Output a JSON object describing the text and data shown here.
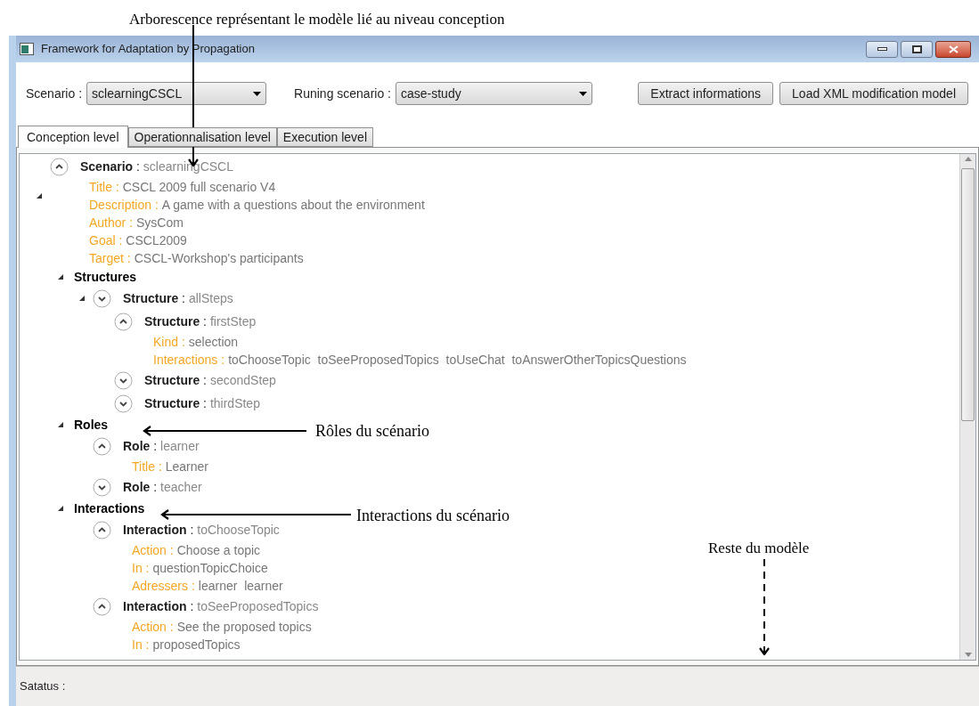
{
  "annotations": [
    {
      "text": "Arborescence représentant le modèle lié au niveau conception",
      "kind": "solid"
    },
    {
      "text": "Rôles du scénario",
      "kind": "solid"
    },
    {
      "text": "Interactions du scénario",
      "kind": "solid"
    },
    {
      "text": "Reste du modèle",
      "kind": "dashed"
    }
  ],
  "window": {
    "title": "Framework for Adaptation by Propagation"
  },
  "toolbar": {
    "scenario_label": "Scenario :",
    "scenario_value": "sclearningCSCL",
    "running_label": "Runing scenario :",
    "running_value": "case-study",
    "buttons": [
      "Extract informations",
      "Load XML modification model"
    ]
  },
  "tabs": [
    {
      "label": "Conception level",
      "selected": true
    },
    {
      "label": "Operationnalisation level",
      "selected": false
    },
    {
      "label": "Execution level",
      "selected": false
    }
  ],
  "tree": [
    {
      "kind": "element",
      "label": "**Scenario** :",
      "value": "sclearningCSCL",
      "expanded": true,
      "expander": true,
      "children": [
        {
          "kind": "property",
          "key": "Title :",
          "value": "CSCL 2009 full scenario V4"
        },
        {
          "kind": "property",
          "key": "Description :",
          "value": "A game with a questions about the environment"
        },
        {
          "kind": "property",
          "key": "Author :",
          "value": "SysCom"
        },
        {
          "kind": "property",
          "key": "Goal :",
          "value": "CSCL2009"
        },
        {
          "kind": "property",
          "key": "Target :",
          "value": "CSCL-Workshop's participants"
        },
        {
          "kind": "section",
          "label": "Structures",
          "expanded": true,
          "children": [
            {
              "kind": "element",
              "label": "**Structure** :",
              "value": "allSteps",
              "expanded": false,
              "expander": true,
              "children": [
                {
                  "kind": "element",
                  "label": "**Structure** :",
                  "value": "firstStep",
                  "expanded": true,
                  "children": [
                    {
                      "kind": "property",
                      "key": "Kind :",
                      "value": "selection"
                    },
                    {
                      "kind": "property",
                      "key": "Interactions :",
                      "value": "toChooseTopic  toSeeProposedTopics  toUseChat  toAnswerOtherTopicsQuestions"
                    }
                  ]
                },
                {
                  "kind": "element",
                  "label": "**Structure** :",
                  "value": "secondStep",
                  "expanded": false
                },
                {
                  "kind": "element",
                  "label": "**Structure** :",
                  "value": "thirdStep",
                  "expanded": false
                }
              ]
            }
          ]
        },
        {
          "kind": "section",
          "label": "Roles",
          "expanded": true,
          "children": [
            {
              "kind": "element",
              "label": "**Role** :",
              "value": "learner",
              "expanded": true,
              "children": [
                {
                  "kind": "property",
                  "key": "Title :",
                  "value": "Learner"
                }
              ]
            },
            {
              "kind": "element",
              "label": "**Role** :",
              "value": "teacher",
              "expanded": false
            }
          ]
        },
        {
          "kind": "section",
          "label": "Interactions",
          "expanded": true,
          "children": [
            {
              "kind": "element",
              "label": "**Interaction** :",
              "value": "toChooseTopic",
              "expanded": true,
              "children": [
                {
                  "kind": "property",
                  "key": "Action :",
                  "value": "Choose a topic"
                },
                {
                  "kind": "property",
                  "key": "In :",
                  "value": "questionTopicChoice"
                },
                {
                  "kind": "property",
                  "key": "Adressers :",
                  "value": "learner  learner"
                }
              ]
            },
            {
              "kind": "element",
              "label": "**Interaction** :",
              "value": "toSeeProposedTopics",
              "expanded": true,
              "children": [
                {
                  "kind": "property",
                  "key": "Action :",
                  "value": "See the proposed topics"
                },
                {
                  "kind": "property",
                  "key": "In :",
                  "value": "proposedTopics"
                }
              ]
            }
          ]
        }
      ]
    }
  ],
  "status_bar": {
    "label": "Satatus :"
  }
}
